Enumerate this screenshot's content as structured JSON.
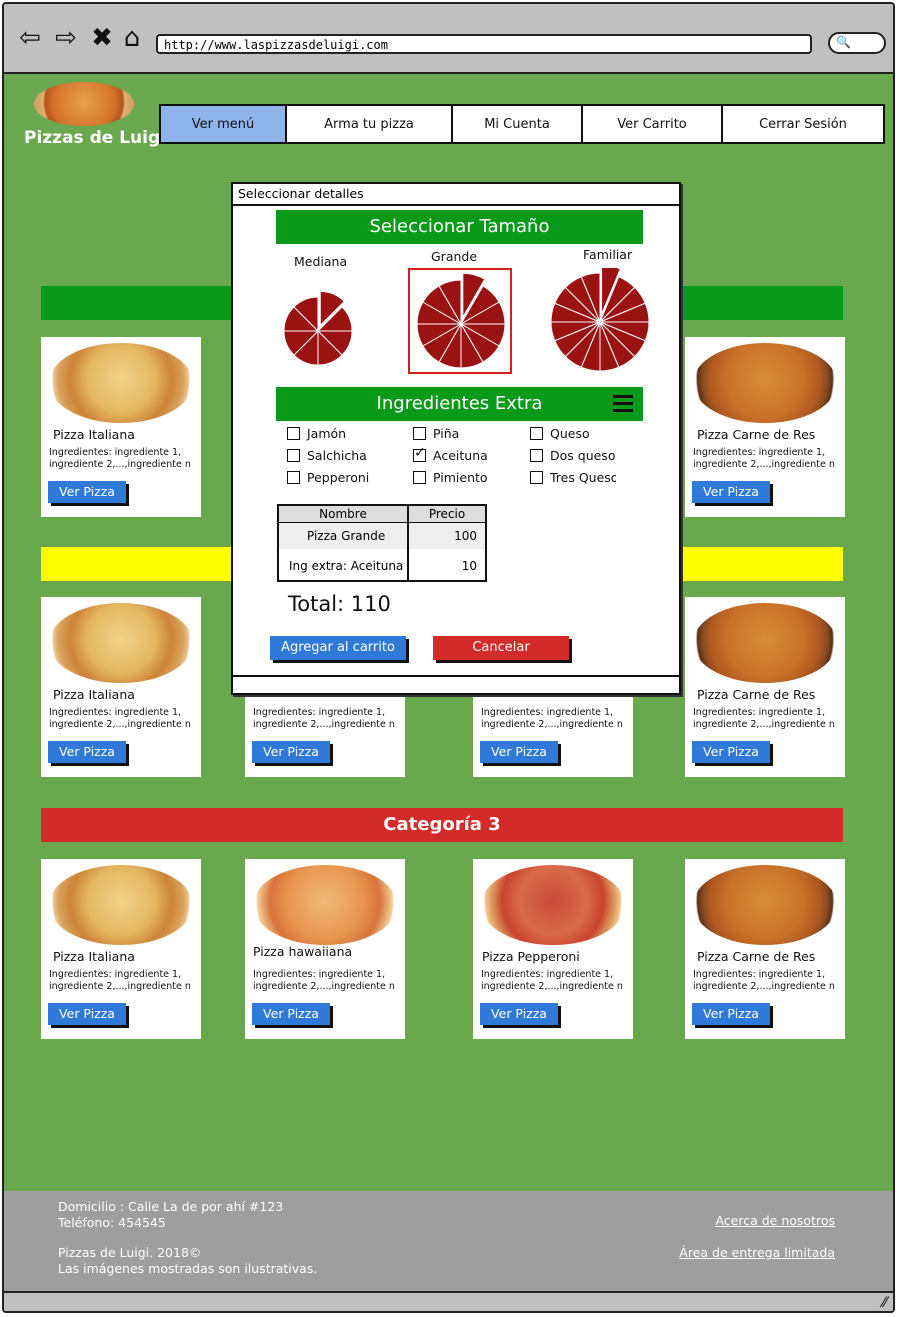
{
  "browser": {
    "url": "http://www.laspizzasdeluigi.com",
    "icons": [
      "back-icon",
      "forward-icon",
      "close-icon",
      "home-icon",
      "search-icon"
    ]
  },
  "header": {
    "brand": "Pizzas de Luigi",
    "nav": [
      {
        "label": "Ver menú",
        "active": true
      },
      {
        "label": "Arma tu pizza",
        "active": false
      },
      {
        "label": "Mi Cuenta",
        "active": false
      },
      {
        "label": "Ver Carrito",
        "active": false
      },
      {
        "label": "Cerrar Sesión",
        "active": false
      }
    ]
  },
  "colors": {
    "page_bg": "#6aa84f",
    "category1": "#0a9a1a",
    "category2": "#ffff00",
    "category3": "#d32a2a",
    "button_blue": "#2f7ad8",
    "pizza_slice": "#9b1212"
  },
  "categories": [
    {
      "title": "",
      "cards": [
        {
          "title": "Pizza Italiana",
          "desc": "Ingredientes: ingrediente 1, ingrediente 2,...,ingrediente n",
          "button": "Ver Pizza"
        },
        {
          "title": "Pizza Carne de Res",
          "desc": "Ingredientes: ingrediente 1, ingrediente 2,...,ingrediente n",
          "button": "Ver Pizza"
        }
      ]
    },
    {
      "title": "",
      "cards": [
        {
          "title": "Pizza Italiana",
          "desc": "Ingredientes: ingrediente 1, ingrediente 2,...,ingrediente n",
          "button": "Ver Pizza"
        },
        {
          "title": "",
          "desc": "Ingredientes: ingrediente 1, ingrediente 2,...,ingrediente n",
          "button": "Ver Pizza"
        },
        {
          "title": "",
          "desc": "Ingredientes: ingrediente 1, ingrediente 2,...,ingrediente n",
          "button": "Ver Pizza"
        },
        {
          "title": "Pizza Carne de Res",
          "desc": "Ingredientes: ingrediente 1, ingrediente 2,...,ingrediente n",
          "button": "Ver Pizza"
        }
      ]
    },
    {
      "title": "Categoría 3",
      "cards": [
        {
          "title": "Pizza Italiana",
          "desc": "Ingredientes: ingrediente 1, ingrediente 2,...,ingrediente n",
          "button": "Ver Pizza"
        },
        {
          "title": "Pizza hawaiiana",
          "desc": "Ingredientes: ingrediente 1, ingrediente 2,...,ingrediente n",
          "button": "Ver Pizza"
        },
        {
          "title": "Pizza Pepperoni",
          "desc": "Ingredientes: ingrediente 1, ingrediente 2,...,ingrediente n",
          "button": "Ver Pizza"
        },
        {
          "title": "Pizza Carne de Res",
          "desc": "Ingredientes: ingrediente 1, ingrediente 2,...,ingrediente n",
          "button": "Ver Pizza"
        }
      ]
    }
  ],
  "modal": {
    "title": "Seleccionar detalles",
    "size_header": "Seleccionar Tamaño",
    "sizes": [
      {
        "label": "Mediana",
        "selected": false
      },
      {
        "label": "Grande",
        "selected": true
      },
      {
        "label": "Familiar",
        "selected": false
      }
    ],
    "ingredients_header": "Ingredientes Extra",
    "ingredients": [
      {
        "label": "Jamón",
        "checked": false
      },
      {
        "label": "Piña",
        "checked": false
      },
      {
        "label": "Queso",
        "checked": false
      },
      {
        "label": "Salchicha",
        "checked": false
      },
      {
        "label": "Aceituna",
        "checked": true
      },
      {
        "label": "Dos quesos",
        "checked": false
      },
      {
        "label": "Pepperoni",
        "checked": false
      },
      {
        "label": "Pimiento",
        "checked": false
      },
      {
        "label": "Tres Quesos",
        "checked": false
      }
    ],
    "table": {
      "headers": [
        "Nombre",
        "Precio"
      ],
      "rows": [
        [
          "Pizza Grande",
          "100"
        ],
        [
          "Ing extra: Aceituna",
          "10"
        ]
      ]
    },
    "total": "Total: 110",
    "add_button": "Agregar al carrito",
    "cancel_button": "Cancelar"
  },
  "footer": {
    "address": "Domicilio : Calle La de por ahí #123",
    "phone": "Teléfono: 454545",
    "copyright": "Pizzas de Luigi. 2018©",
    "disclaimer": "Las imágenes mostradas son ilustrativas.",
    "about_link": "Acerca de nosotros",
    "delivery_link": "Área de entrega limitada"
  }
}
